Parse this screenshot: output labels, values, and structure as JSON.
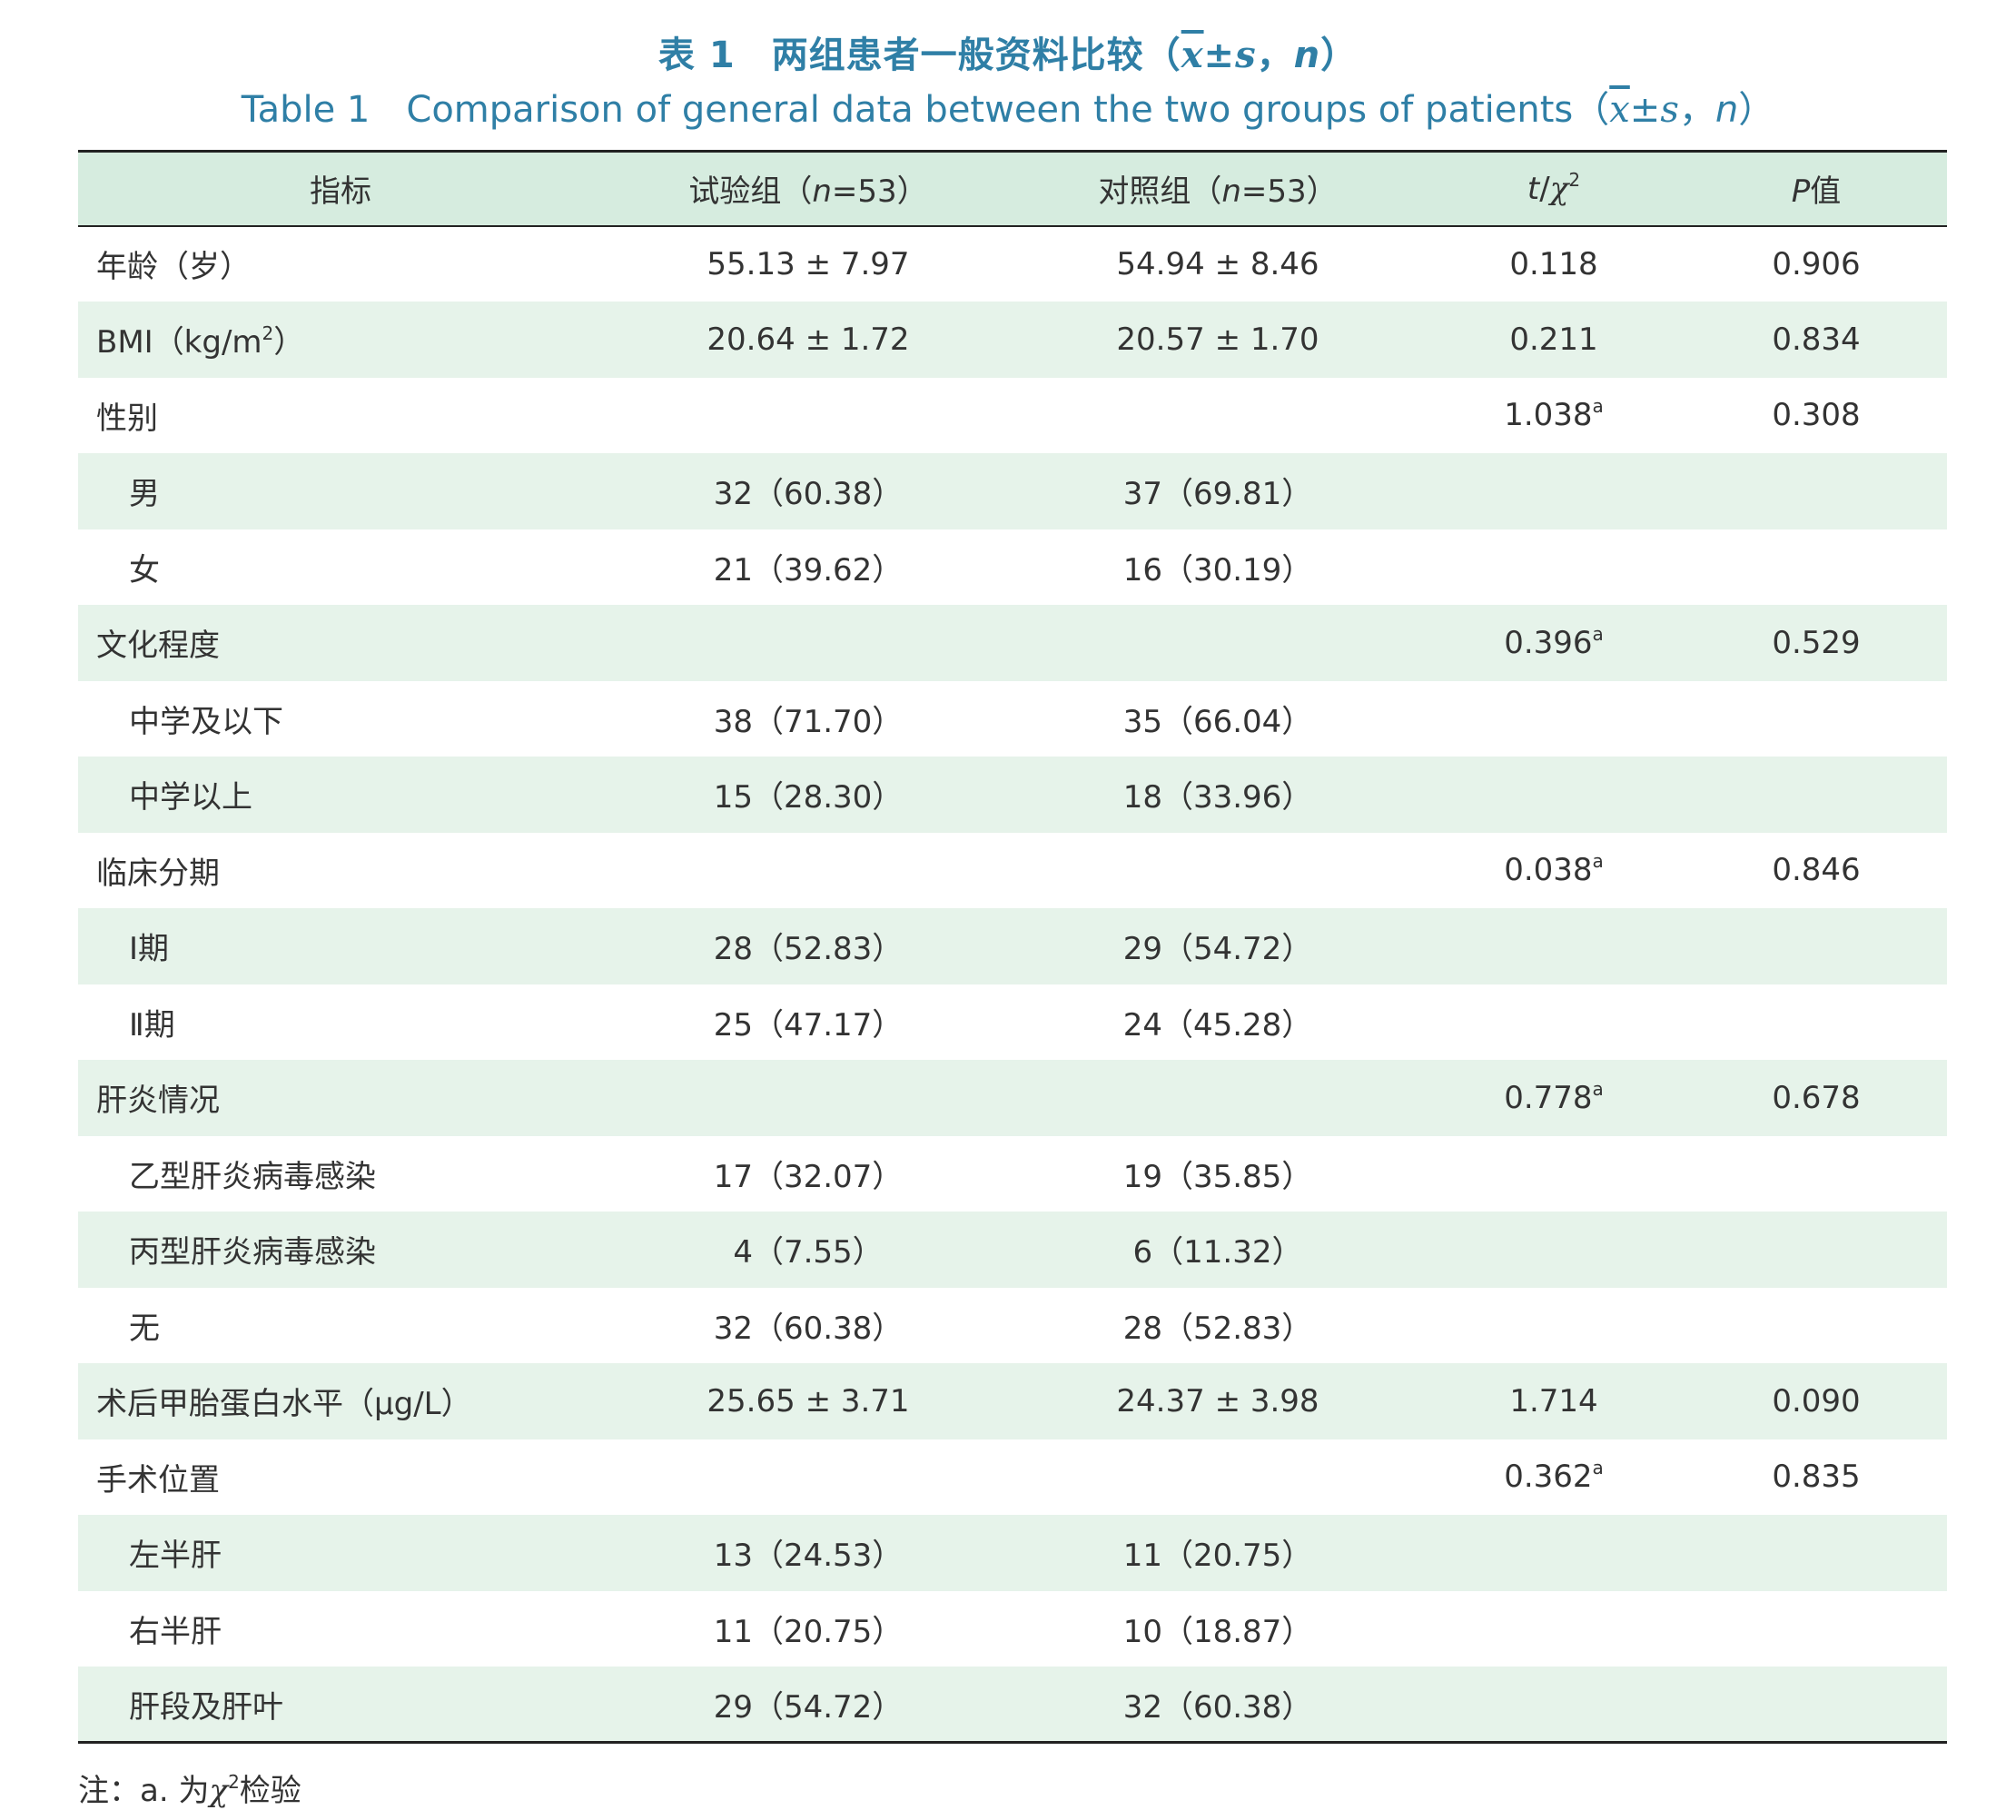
{
  "caption": {
    "cn_prefix": "表 1",
    "cn_title": "两组患者一般资料比较（",
    "en_prefix": "Table 1",
    "en_title": "Comparison of general data between the two groups of patients（",
    "stat_mean": "x",
    "stat_pm": "±",
    "stat_sd": "s",
    "stat_sep": "，",
    "stat_n": "n",
    "close": "）"
  },
  "header": {
    "indicator": "指标",
    "test_group_pre": "试验组（",
    "test_group_n": "n",
    "test_group_post": "=53）",
    "control_group_pre": "对照组（",
    "control_group_n": "n",
    "control_group_post": "=53）",
    "stat_t": "t",
    "stat_slash": "/",
    "stat_chi": "χ",
    "stat_chi_sup": "2",
    "p_letter": "P",
    "p_suffix": "值"
  },
  "rows": [
    {
      "label": "年龄（岁）",
      "test": "55.13 ± 7.97",
      "control": "54.94 ± 8.46",
      "stat": "0.118",
      "stat_sup": "",
      "p": "0.906",
      "sub": false
    },
    {
      "label": "BMI（kg/m",
      "label_sup": "2",
      "label_post": "）",
      "test": "20.64 ± 1.72",
      "control": "20.57 ± 1.70",
      "stat": "0.211",
      "stat_sup": "",
      "p": "0.834",
      "sub": false
    },
    {
      "label": "性别",
      "test": "",
      "control": "",
      "stat": "1.038",
      "stat_sup": "a",
      "p": "0.308",
      "sub": false
    },
    {
      "label": "男",
      "test": "32（60.38）",
      "control": "37（69.81）",
      "stat": "",
      "stat_sup": "",
      "p": "",
      "sub": true
    },
    {
      "label": "女",
      "test": "21（39.62）",
      "control": "16（30.19）",
      "stat": "",
      "stat_sup": "",
      "p": "",
      "sub": true
    },
    {
      "label": "文化程度",
      "test": "",
      "control": "",
      "stat": "0.396",
      "stat_sup": "a",
      "p": "0.529",
      "sub": false
    },
    {
      "label": "中学及以下",
      "test": "38（71.70）",
      "control": "35（66.04）",
      "stat": "",
      "stat_sup": "",
      "p": "",
      "sub": true
    },
    {
      "label": "中学以上",
      "test": "15（28.30）",
      "control": "18（33.96）",
      "stat": "",
      "stat_sup": "",
      "p": "",
      "sub": true
    },
    {
      "label": "临床分期",
      "test": "",
      "control": "",
      "stat": "0.038",
      "stat_sup": "a",
      "p": "0.846",
      "sub": false
    },
    {
      "label": "Ⅰ期",
      "test": "28（52.83）",
      "control": "29（54.72）",
      "stat": "",
      "stat_sup": "",
      "p": "",
      "sub": true
    },
    {
      "label": "Ⅱ期",
      "test": "25（47.17）",
      "control": "24（45.28）",
      "stat": "",
      "stat_sup": "",
      "p": "",
      "sub": true
    },
    {
      "label": "肝炎情况",
      "test": "",
      "control": "",
      "stat": "0.778",
      "stat_sup": "a",
      "p": "0.678",
      "sub": false
    },
    {
      "label": "乙型肝炎病毒感染",
      "test": "17（32.07）",
      "control": "19（35.85）",
      "stat": "",
      "stat_sup": "",
      "p": "",
      "sub": true
    },
    {
      "label": "丙型肝炎病毒感染",
      "test": "4（7.55）",
      "control": "6（11.32）",
      "stat": "",
      "stat_sup": "",
      "p": "",
      "sub": true
    },
    {
      "label": "无",
      "test": "32（60.38）",
      "control": "28（52.83）",
      "stat": "",
      "stat_sup": "",
      "p": "",
      "sub": true
    },
    {
      "label": "术后甲胎蛋白水平（μg/L）",
      "test": "25.65 ± 3.71",
      "control": "24.37 ± 3.98",
      "stat": "1.714",
      "stat_sup": "",
      "p": "0.090",
      "sub": false
    },
    {
      "label": "手术位置",
      "test": "",
      "control": "",
      "stat": "0.362",
      "stat_sup": "a",
      "p": "0.835",
      "sub": false
    },
    {
      "label": "左半肝",
      "test": "13（24.53）",
      "control": "11（20.75）",
      "stat": "",
      "stat_sup": "",
      "p": "",
      "sub": true
    },
    {
      "label": "右半肝",
      "test": "11（20.75）",
      "control": "10（18.87）",
      "stat": "",
      "stat_sup": "",
      "p": "",
      "sub": true
    },
    {
      "label": "肝段及肝叶",
      "test": "29（54.72）",
      "control": "32（60.38）",
      "stat": "",
      "stat_sup": "",
      "p": "",
      "sub": true
    }
  ],
  "note": {
    "prefix": "注：a. 为",
    "chi": "χ",
    "chi_sup": "2",
    "suffix": "检验"
  },
  "colors": {
    "caption": "#2f7fa6",
    "header_bg": "#d6ecdf",
    "shade_bg": "#e6f3ea",
    "rule": "#222222"
  }
}
